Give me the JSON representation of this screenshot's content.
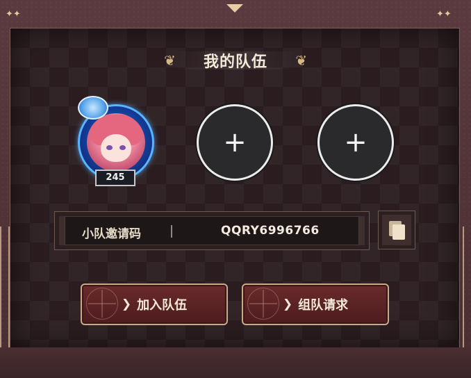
{
  "panel": {
    "title": "我的队伍",
    "laurel_left_icon": "laurel-left-icon",
    "laurel_right_icon": "laurel-right-icon"
  },
  "team": {
    "members": [
      {
        "type": "player",
        "level": "245",
        "avatar_icon": "player-avatar-icon"
      },
      {
        "type": "empty",
        "label": "+"
      },
      {
        "type": "empty",
        "label": "+"
      }
    ]
  },
  "invite": {
    "label": "小队邀请码",
    "code": "QQRY6996766",
    "copy_icon": "copy-icon"
  },
  "actions": {
    "join_label": "加入队伍",
    "request_label": "组队请求"
  },
  "colors": {
    "frame": "#4a2e32",
    "panel": "#2b1d1f",
    "gold": "#e3c99b",
    "button_red": "#6a2a2b",
    "avatar_ring_blue": "#5ab4ff"
  }
}
